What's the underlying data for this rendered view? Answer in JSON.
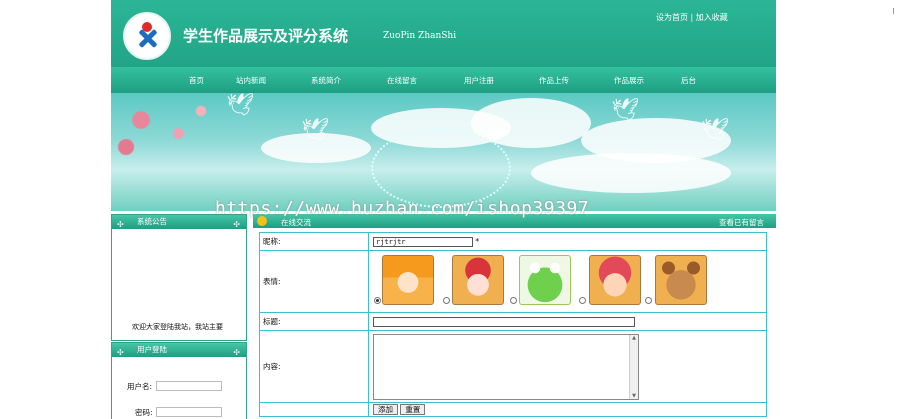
{
  "header": {
    "title": "学生作品展示及评分系统",
    "subtitle": "ZuoPin ZhanShi",
    "link_home": "设为首页",
    "separator": " | ",
    "link_fav": "加入收藏"
  },
  "nav": [
    "首页",
    "站内新闻",
    "系统简介",
    "在线留言",
    "用户注册",
    "作品上传",
    "作品展示",
    "后台"
  ],
  "watermark": "https://www.huzhan.com/ishop39397",
  "sidebar": {
    "notice_title": "系统公告",
    "notice_text": "欢迎大家登陆我站，我站主要",
    "login_title": "用户登陆",
    "username_label": "用户名:",
    "password_label": "密码:"
  },
  "main": {
    "title": "在线交流",
    "link": "查看已有留言",
    "nickname_label": "昵称:",
    "nickname_value": "rjtrjtr",
    "required_mark": "*",
    "face_label": "表情:",
    "faces": [
      "face-1",
      "face-2",
      "face-3",
      "face-4",
      "face-5"
    ],
    "face_selected": 0,
    "subject_label": "标题:",
    "content_label": "内容:",
    "submit_label": "添加",
    "reset_label": "重置"
  }
}
